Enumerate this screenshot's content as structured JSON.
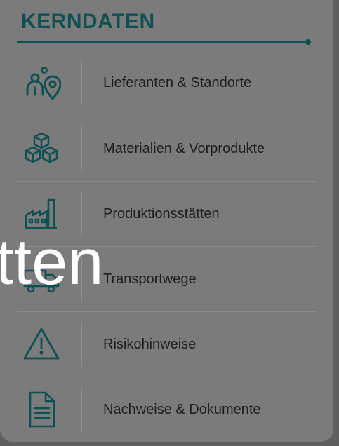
{
  "header": {
    "title": "KERNDATEN",
    "accent_color": "#0f5052"
  },
  "items": [
    {
      "label": "Lieferanten & Standorte",
      "icon": "people-location-icon"
    },
    {
      "label": "Materialien & Vorprodukte",
      "icon": "boxes-icon"
    },
    {
      "label": "Produktionsstätten",
      "icon": "factory-icon"
    },
    {
      "label": "Transportwege",
      "icon": "truck-icon"
    },
    {
      "label": "Risikohinweise",
      "icon": "warning-triangle-icon"
    },
    {
      "label": "Nachweise & Dokumente",
      "icon": "document-icon"
    }
  ],
  "overlay": {
    "text": "tten"
  }
}
